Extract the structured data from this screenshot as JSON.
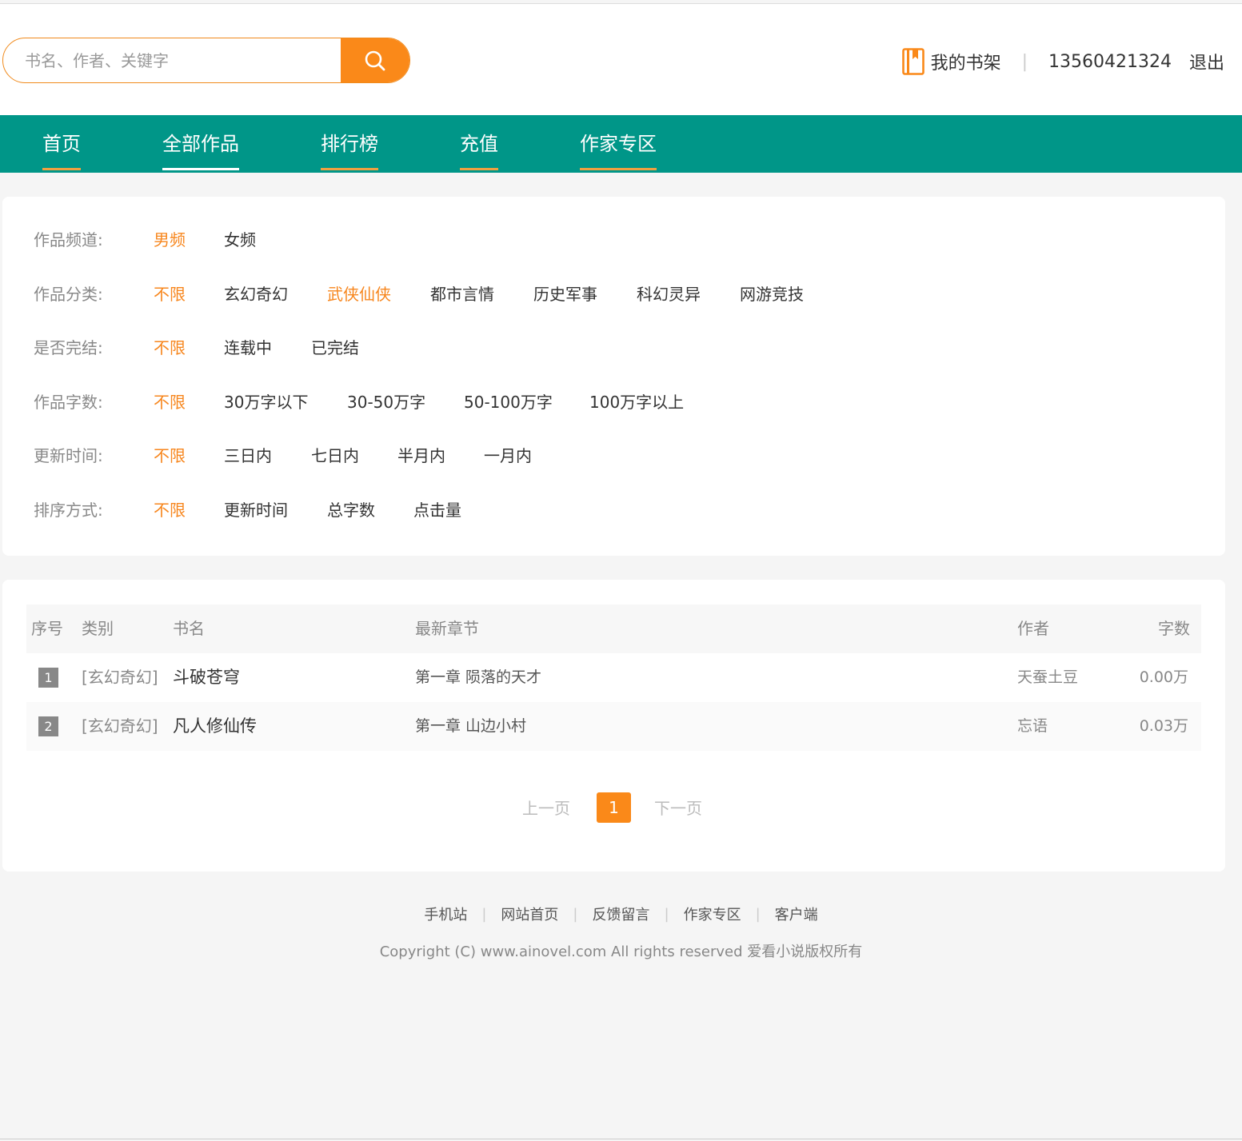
{
  "search": {
    "placeholder": "书名、作者、关键字"
  },
  "user": {
    "shelf_label": "我的书架",
    "separator": "|",
    "phone": "13560421324",
    "logout": "退出"
  },
  "nav": [
    {
      "label": "首页"
    },
    {
      "label": "全部作品"
    },
    {
      "label": "排行榜"
    },
    {
      "label": "充值"
    },
    {
      "label": "作家专区"
    }
  ],
  "nav_active": "全部作品",
  "filters": [
    {
      "label": "作品频道:",
      "options": [
        "男频",
        "女频"
      ],
      "selected": "男频"
    },
    {
      "label": "作品分类:",
      "options": [
        "不限",
        "玄幻奇幻",
        "武侠仙侠",
        "都市言情",
        "历史军事",
        "科幻灵异",
        "网游竞技"
      ],
      "selected": [
        "不限",
        "武侠仙侠"
      ]
    },
    {
      "label": "是否完结:",
      "options": [
        "不限",
        "连载中",
        "已完结"
      ],
      "selected": "不限"
    },
    {
      "label": "作品字数:",
      "options": [
        "不限",
        "30万字以下",
        "30-50万字",
        "50-100万字",
        "100万字以上"
      ],
      "selected": "不限"
    },
    {
      "label": "更新时间:",
      "options": [
        "不限",
        "三日内",
        "七日内",
        "半月内",
        "一月内"
      ],
      "selected": "不限"
    },
    {
      "label": "排序方式:",
      "options": [
        "不限",
        "更新时间",
        "总字数",
        "点击量"
      ],
      "selected": "不限"
    }
  ],
  "table": {
    "headers": {
      "rank": "序号",
      "category": "类别",
      "title": "书名",
      "chapter": "最新章节",
      "author": "作者",
      "words": "字数"
    },
    "rows": [
      {
        "rank": "1",
        "category": "[玄幻奇幻]",
        "title": "斗破苍穹",
        "chapter": "第一章 陨落的天才",
        "author": "天蚕土豆",
        "words": "0.00万"
      },
      {
        "rank": "2",
        "category": "[玄幻奇幻]",
        "title": "凡人修仙传",
        "chapter": "第一章 山边小村",
        "author": "忘语",
        "words": "0.03万"
      }
    ]
  },
  "pager": {
    "prev": "上一页",
    "current": "1",
    "next": "下一页"
  },
  "footer": {
    "links": [
      "手机站",
      "网站首页",
      "反馈留言",
      "作家专区",
      "客户端"
    ],
    "separator": "|",
    "copyright": "Copyright (C) www.ainovel.com All rights reserved 爱看小说版权所有"
  },
  "colors": {
    "accent": "#fa8919",
    "nav_bg": "#009688",
    "selected_text": "#f7861d"
  },
  "icons": {
    "search": "search-icon",
    "shelf": "bookshelf-icon"
  }
}
